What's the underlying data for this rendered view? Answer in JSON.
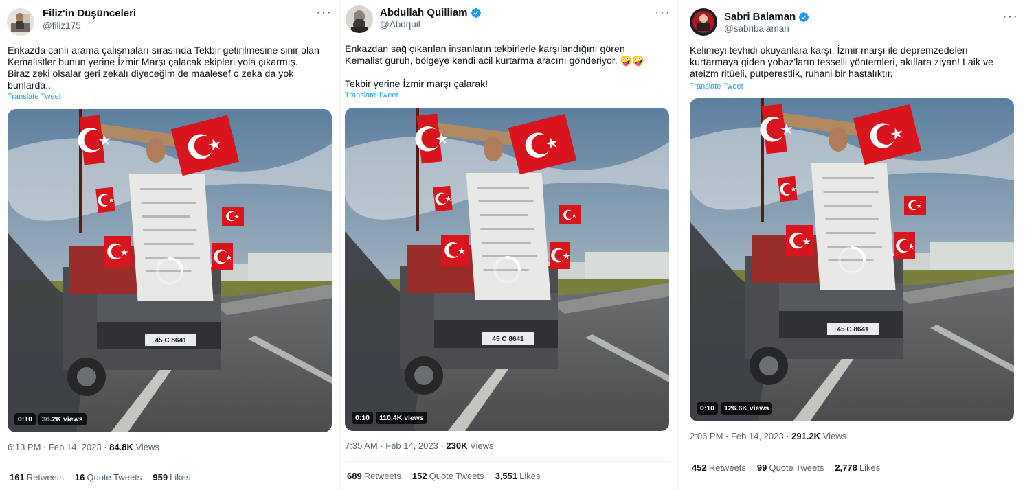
{
  "tweets": [
    {
      "name": "Filiz'in Düşünceleri",
      "handle": "@filiz175",
      "verified": false,
      "text": "Enkazda canlı arama çalışmaları sırasında Tekbir getirilmesine sinir olan\nKemalistler bunun yerine İzmir Marşı çalacak ekipleri yola çıkarmış.\nBiraz zeki olsalar geri zekalı diyeceğim de maalesef o zeka da yok\nbunlarda..",
      "translate": "Translate Tweet",
      "duration": "0:10",
      "video_views": "36.2K views",
      "time": "6:13 PM · Feb 14, 2023 · ",
      "views_count": "84.8K",
      "views_label": " Views",
      "retweets": "161",
      "retweets_label": "Retweets",
      "quotes": "16",
      "quotes_label": "Quote Tweets",
      "likes": "959",
      "likes_label": "Likes",
      "plate": "45 C 8641"
    },
    {
      "name": "Abdullah Quilliam",
      "handle": "@Abdquil",
      "verified": true,
      "text": "Enkazdan sağ çıkarılan insanların tekbirlerle karşılandığını gören\nKemalist güruh, bölgeye kendi acil kurtarma aracını gönderiyor. 🤪🤪\n\nTekbir yerine İzmir marşı çalarak!",
      "translate": "Translate Tweet",
      "duration": "0:10",
      "video_views": "110.4K views",
      "time": "7:35 AM · Feb 14, 2023 · ",
      "views_count": "230K",
      "views_label": " Views",
      "retweets": "689",
      "retweets_label": "Retweets",
      "quotes": "152",
      "quotes_label": "Quote Tweets",
      "likes": "3,551",
      "likes_label": "Likes",
      "plate": "45 C 8641"
    },
    {
      "name": "Sabri Balaman",
      "handle": "@sabribalaman",
      "verified": true,
      "text": "Kelimeyi tevhidi okuyanlara karşı, İzmir marşı ile depremzedeleri\nkurtarmaya giden yobaz'ların tesselli yöntemleri, akıllara ziyan! Laik ve\nateizm ritüeli, putperestlik, ruhani bir hastalıktır,",
      "translate": "Translate Tweet",
      "duration": "0:10",
      "video_views": "126.6K views",
      "time": "2:06 PM · Feb 14, 2023 · ",
      "views_count": "291.2K",
      "views_label": " Views",
      "retweets": "452",
      "retweets_label": "Retweets",
      "quotes": "99",
      "quotes_label": "Quote Tweets",
      "likes": "2,778",
      "likes_label": "Likes",
      "plate": "45 C 8641"
    }
  ],
  "colors": {
    "accent": "#1d9bf0",
    "muted": "#536471",
    "flag_red": "#d8141c"
  },
  "icons": [
    "more-icon",
    "verified-badge-icon",
    "loading-spinner-icon"
  ]
}
